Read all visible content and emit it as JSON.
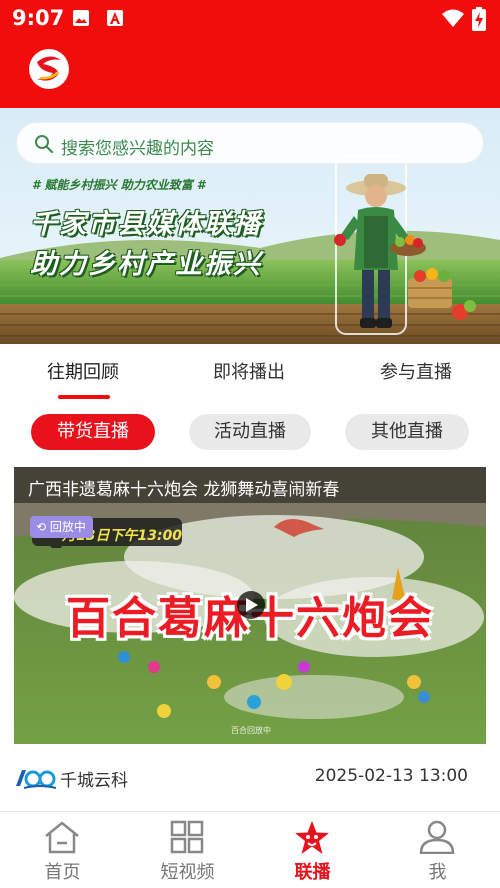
{
  "status_bar": {
    "time": "9:07"
  },
  "search": {
    "placeholder": "搜索您感兴趣的内容"
  },
  "banner": {
    "tagline": "# 赋能乡村振兴  助力农业致富 #",
    "title_line1": "千家市县媒体联播",
    "title_line2": "助力乡村产业振兴"
  },
  "tabs": [
    {
      "label": "往期回顾",
      "active": true
    },
    {
      "label": "即将播出",
      "active": false
    },
    {
      "label": "参与直播",
      "active": false
    }
  ],
  "categories": [
    {
      "label": "带货直播",
      "active": true
    },
    {
      "label": "活动直播",
      "active": false
    },
    {
      "label": "其他直播",
      "active": false
    }
  ],
  "video": {
    "title": "广西非遗葛麻十六炮会 龙狮舞动喜闹新春",
    "badge": "回放中",
    "poster_time": "月13日下午13:00",
    "poster_title": "百合葛麻十六炮会",
    "watermark": "百合回放中",
    "source": "千城云科",
    "date": "2025-02-13 13:00"
  },
  "bottom_nav": [
    {
      "label": "首页",
      "icon": "home-icon",
      "active": false
    },
    {
      "label": "短视频",
      "icon": "grid-icon",
      "active": false
    },
    {
      "label": "联播",
      "icon": "star-icon",
      "active": true
    },
    {
      "label": "我",
      "icon": "person-icon",
      "active": false
    }
  ],
  "colors": {
    "brand_red": "#f20d0d",
    "chip_active": "#e8121d",
    "nav_active": "#e8121d"
  }
}
